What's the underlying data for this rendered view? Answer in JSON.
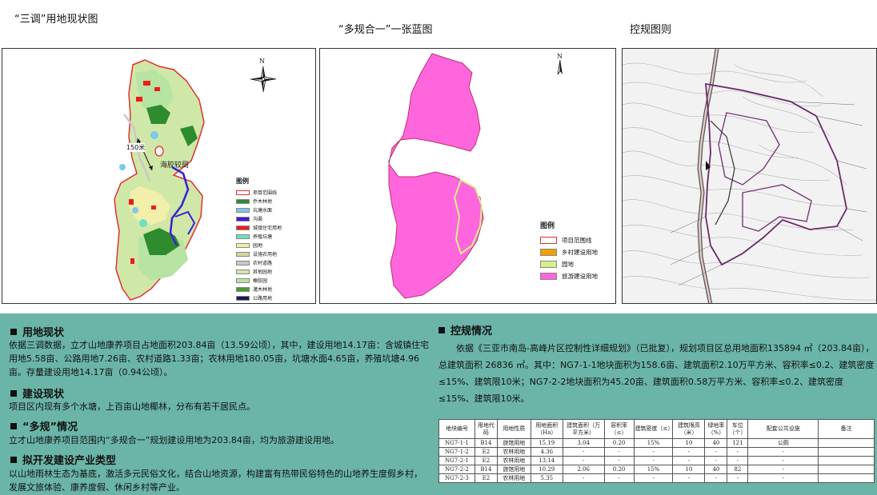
{
  "titles": {
    "current_status": "“三调”用地现状图",
    "blueprint": "“多规合一”一张蓝图",
    "regulatory": "控规图则"
  },
  "map1": {
    "distance_label": "150米",
    "place_label": "海胶较局",
    "north": "N",
    "legend": {
      "title": "图例",
      "items": [
        {
          "label": "项目范围线",
          "color": "#ffffff",
          "stroke": "#e03030"
        },
        {
          "label": "乔木林地",
          "color": "#2e8b2e"
        },
        {
          "label": "坑塘水面",
          "color": "#7ec8e8"
        },
        {
          "label": "沟渠",
          "color": "#3a1fd6"
        },
        {
          "label": "城镇住宅用地",
          "color": "#ee1c1c"
        },
        {
          "label": "养殖坑塘",
          "color": "#6ce0c0"
        },
        {
          "label": "园地",
          "color": "#f2efaa"
        },
        {
          "label": "设施农用地",
          "color": "#d8d59a"
        },
        {
          "label": "农村道路",
          "color": "#c8c8c8"
        },
        {
          "label": "其他园地",
          "color": "#cfe8a8"
        },
        {
          "label": "橡胶园",
          "color": "#b7e3a3"
        },
        {
          "label": "灌木林地",
          "color": "#4a9a2c"
        },
        {
          "label": "公路用地",
          "color": "#1a1a5e"
        }
      ]
    }
  },
  "map2": {
    "north": "N",
    "legend": {
      "title": "图例",
      "items": [
        {
          "label": "项目范围线",
          "color": "#ffffff",
          "stroke": "#e03030"
        },
        {
          "label": "乡村建设用地",
          "color": "#f0a000"
        },
        {
          "label": "园地",
          "color": "#d8f08a"
        },
        {
          "label": "旅游建设用地",
          "color": "#ff66dd"
        }
      ]
    }
  },
  "sections": {
    "current_status": {
      "heading": "用地现状",
      "text": "依据三调数据，立才山地康养项目占地面积203.84亩（13.59公顷），其中，建设用地14.17亩：含城镇住宅用地5.58亩、公路用地7.26亩、农村道路1.33亩；农林用地180.05亩，坑塘水面4.65亩，养殖坑塘4.96亩。存量建设用地14.17亩（0.94公顷）。"
    },
    "construction": {
      "heading": "建设现状",
      "text": "项目区内现有多个水塘，上百亩山地椰林，分布有若干居民点。"
    },
    "multi_plan": {
      "heading": "“多规”情况",
      "text": "立才山地康养项目范围内“多规合一”规划建设用地为203.84亩，均为旅游建设用地。"
    },
    "industry": {
      "heading": "拟开发建设产业类型",
      "text": "以山地雨林生态为基底，激活多元民俗文化，结合山地资源，构建富有热带民俗特色的山地养生度假乡村，发展文旅体验、康养度假、休闲乡村等产业。"
    },
    "regulatory": {
      "heading": "控规情况",
      "text": "依据《三亚市南岛-高峰片区控制性详细规划》（已批复），规划项目区总用地面积135894 ㎡（203.84亩），总建筑面积 26836 ㎡。其中：NG7-1-1地块面积为158.6亩、建筑面积2.10万平方米、容积率≤0.2、建筑密度≤15%、建筑限10米；NG7-2-2地块面积为45.20亩、建筑面积0.58万平方米、容积率≤0.2、建筑密度≤15%、建筑限10米。"
    }
  },
  "table": {
    "headers": [
      "地块编号",
      "用地代码",
      "用地性质",
      "用地面积（Ha）",
      "建筑面积（万平方米）",
      "容积率（≤）",
      "建筑密度（≤）",
      "建筑限高（米）",
      "绿地率（%）",
      "车位（个）",
      "配套公共设施",
      "备注"
    ],
    "rows": [
      [
        "NG7-1-1",
        "B14",
        "旅馆用地",
        "15.19",
        "3.04",
        "0.20",
        "15%",
        "10",
        "40",
        "121",
        "公厕",
        ""
      ],
      [
        "NG7-1-2",
        "E2",
        "农林用地",
        "4.36",
        "-",
        "-",
        "-",
        "-",
        "-",
        "-",
        "-",
        ""
      ],
      [
        "NG7-2-1",
        "E2",
        "农林用地",
        "13.14",
        "-",
        "-",
        "-",
        "-",
        "-",
        "-",
        "-",
        ""
      ],
      [
        "NG7-2-2",
        "B14",
        "旅馆用地",
        "10.29",
        "2.06",
        "0.20",
        "15%",
        "10",
        "40",
        "82",
        "-",
        ""
      ],
      [
        "NG7-2-3",
        "E2",
        "农林用地",
        "5.35",
        "-",
        "-",
        "-",
        "-",
        "-",
        "-",
        "-",
        ""
      ]
    ]
  }
}
